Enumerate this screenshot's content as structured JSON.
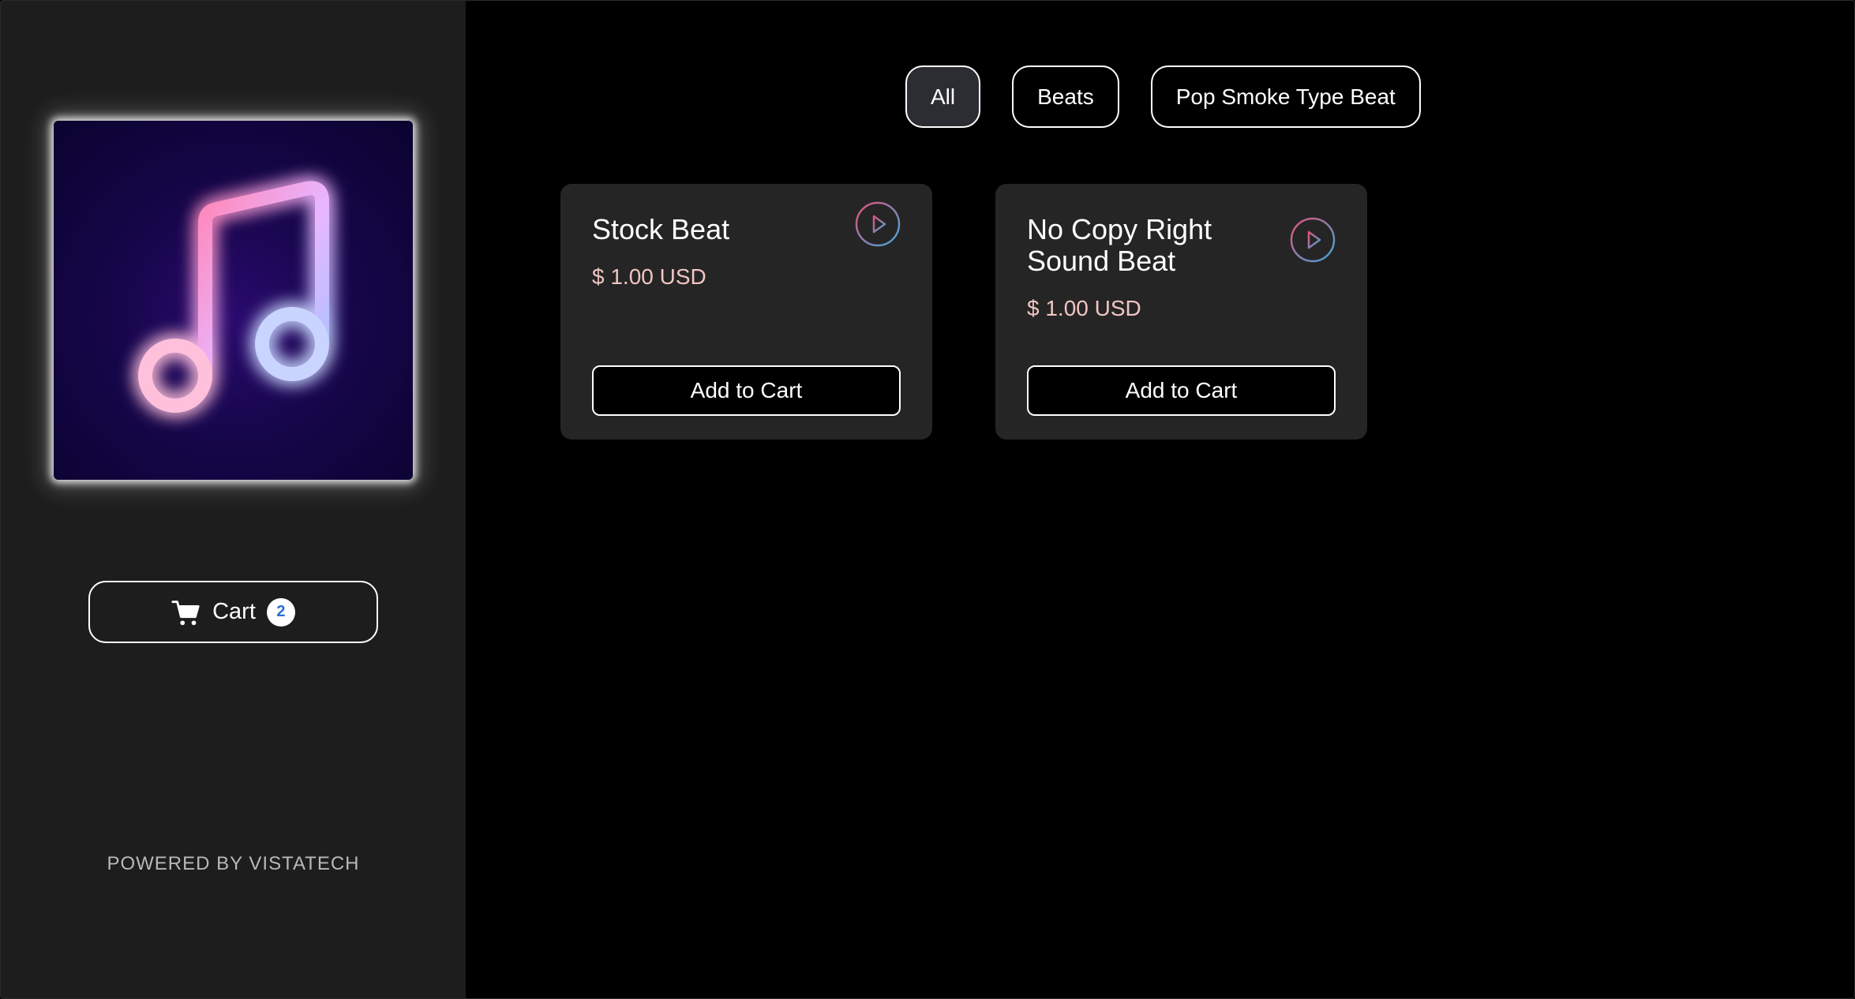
{
  "sidebar": {
    "artwork_icon": "music-note-icon",
    "cart": {
      "label": "Cart",
      "count": "2",
      "icon": "cart-icon"
    },
    "powered_by": "POWERED BY VISTATECH"
  },
  "filters": [
    {
      "label": "All",
      "active": true
    },
    {
      "label": "Beats",
      "active": false
    },
    {
      "label": "Pop Smoke Type Beat",
      "active": false
    }
  ],
  "products": [
    {
      "title": "Stock Beat",
      "price": "$ 1.00 USD",
      "add_label": "Add to Cart",
      "play_icon": "play-icon"
    },
    {
      "title": "No Copy Right Sound Beat",
      "price": "$ 1.00 USD",
      "add_label": "Add to Cart",
      "play_icon": "play-icon"
    }
  ],
  "colors": {
    "page_background": "#000000",
    "sidebar_background": "#1d1d1d",
    "card_background": "#252525",
    "active_chip_background": "#2b2d33",
    "price_text": "#f0c6c2",
    "cart_badge_text": "#2a6fd6",
    "play_gradient_start": "#e0527a",
    "play_gradient_end": "#3ea6d8"
  }
}
